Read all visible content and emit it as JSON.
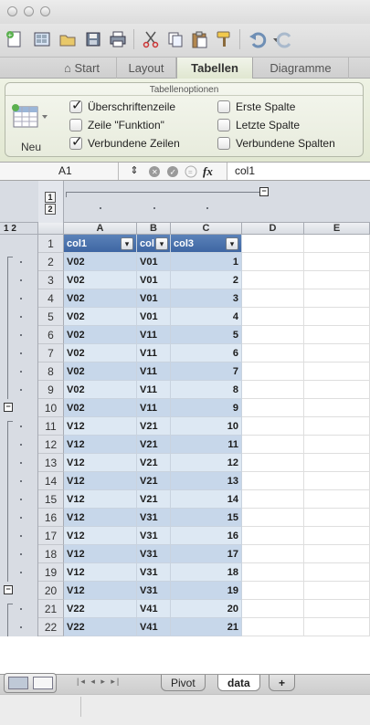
{
  "ribbon": {
    "tabs": [
      {
        "label": "Start"
      },
      {
        "label": "Layout"
      },
      {
        "label": "Tabellen"
      },
      {
        "label": "Diagramme"
      }
    ],
    "group_title": "Tabellenoptionen",
    "new_label": "Neu",
    "options": [
      {
        "label": "Überschriftenzeile",
        "checked": true
      },
      {
        "label": "Zeile \"Funktion\"",
        "checked": false
      },
      {
        "label": "Verbundene Zeilen",
        "checked": true
      },
      {
        "label": "Erste Spalte",
        "checked": false
      },
      {
        "label": "Letzte Spalte",
        "checked": false
      },
      {
        "label": "Verbundene Spalten",
        "checked": false
      }
    ]
  },
  "formula_bar": {
    "cell_ref": "A1",
    "fx_label": "fx",
    "value": "col1"
  },
  "outline": {
    "level_1": "1",
    "level_2": "2",
    "row_levels": "1 2",
    "collapse_symbol": "−"
  },
  "grid": {
    "columns": [
      "A",
      "B",
      "C",
      "D",
      "E"
    ],
    "headers": [
      "col1",
      "col",
      "col3"
    ],
    "filter_symbol": "▾",
    "rows": [
      {
        "n": "2",
        "a": "V02",
        "b": "V01",
        "c": "1"
      },
      {
        "n": "3",
        "a": "V02",
        "b": "V01",
        "c": "2"
      },
      {
        "n": "4",
        "a": "V02",
        "b": "V01",
        "c": "3"
      },
      {
        "n": "5",
        "a": "V02",
        "b": "V01",
        "c": "4"
      },
      {
        "n": "6",
        "a": "V02",
        "b": "V11",
        "c": "5"
      },
      {
        "n": "7",
        "a": "V02",
        "b": "V11",
        "c": "6"
      },
      {
        "n": "8",
        "a": "V02",
        "b": "V11",
        "c": "7"
      },
      {
        "n": "9",
        "a": "V02",
        "b": "V11",
        "c": "8"
      },
      {
        "n": "10",
        "a": "V02",
        "b": "V11",
        "c": "9"
      },
      {
        "n": "11",
        "a": "V12",
        "b": "V21",
        "c": "10"
      },
      {
        "n": "12",
        "a": "V12",
        "b": "V21",
        "c": "11"
      },
      {
        "n": "13",
        "a": "V12",
        "b": "V21",
        "c": "12"
      },
      {
        "n": "14",
        "a": "V12",
        "b": "V21",
        "c": "13"
      },
      {
        "n": "15",
        "a": "V12",
        "b": "V21",
        "c": "14"
      },
      {
        "n": "16",
        "a": "V12",
        "b": "V31",
        "c": "15"
      },
      {
        "n": "17",
        "a": "V12",
        "b": "V31",
        "c": "16"
      },
      {
        "n": "18",
        "a": "V12",
        "b": "V31",
        "c": "17"
      },
      {
        "n": "19",
        "a": "V12",
        "b": "V31",
        "c": "18"
      },
      {
        "n": "20",
        "a": "V12",
        "b": "V31",
        "c": "19"
      },
      {
        "n": "21",
        "a": "V22",
        "b": "V41",
        "c": "20"
      },
      {
        "n": "22",
        "a": "V22",
        "b": "V41",
        "c": "21"
      }
    ]
  },
  "sheets": {
    "tabs": [
      {
        "label": "Pivot",
        "active": false
      },
      {
        "label": "data",
        "active": true
      }
    ],
    "add_label": "+"
  },
  "colors": {
    "accent_tab": "#dfe6cf",
    "table_header": "#4a71ad",
    "band_dark": "#c7d7ea",
    "band_light": "#dde8f3"
  }
}
